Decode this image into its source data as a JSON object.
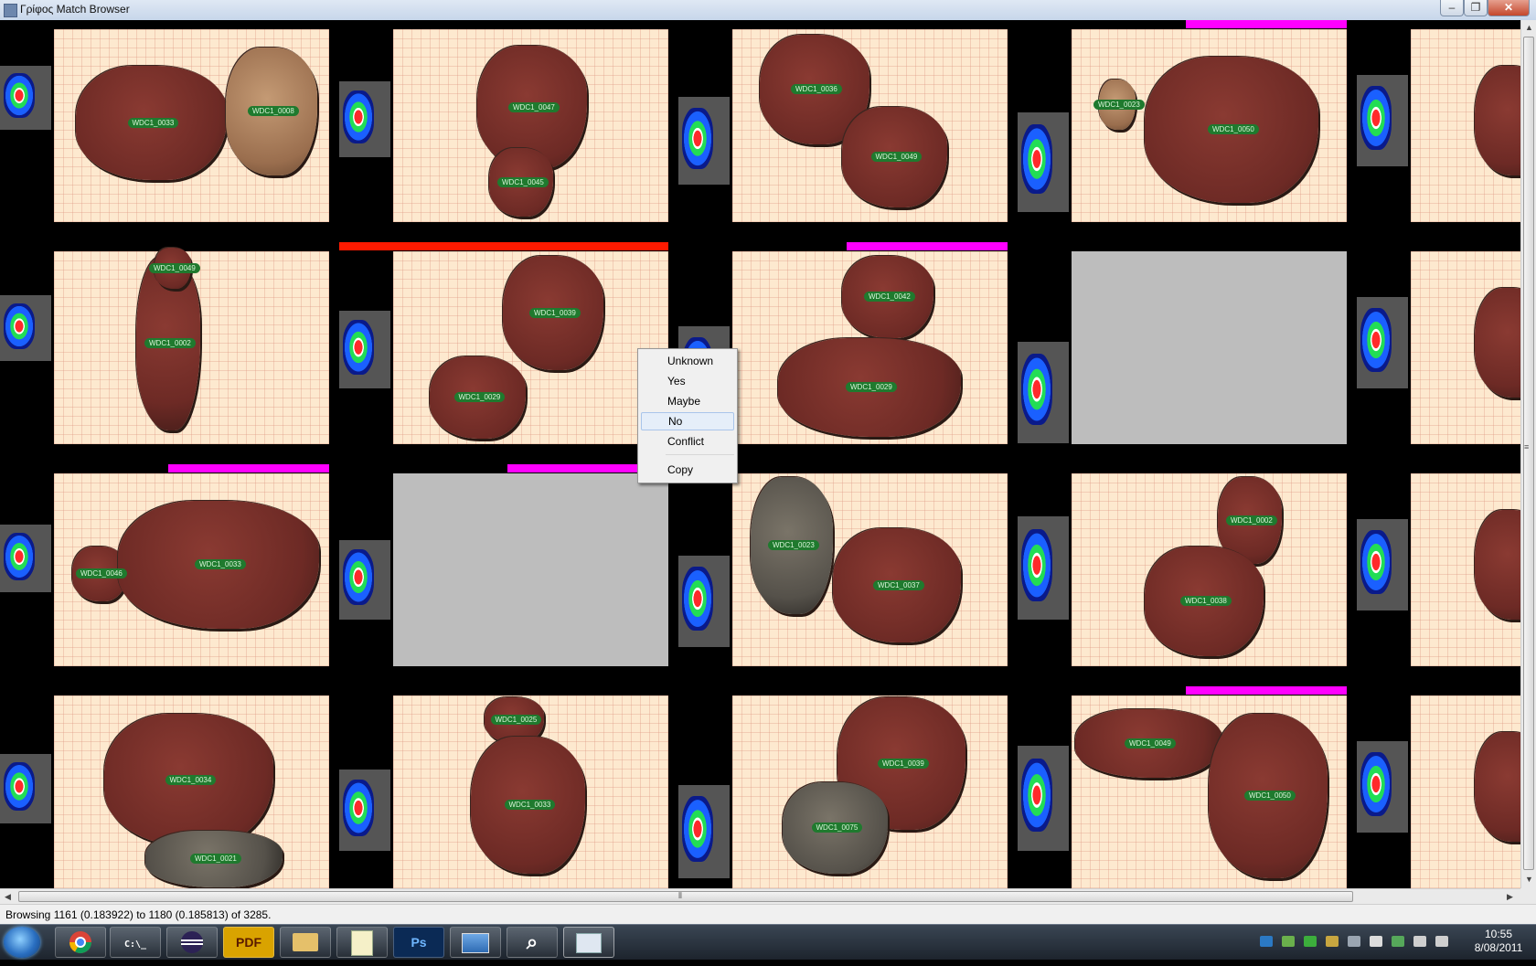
{
  "window": {
    "title": "Γρίφος Match Browser",
    "controls": {
      "minimize_icon": "minimize-icon",
      "maximize_icon": "maximize-icon",
      "close_icon": "close-icon"
    }
  },
  "tiles": [
    {
      "row": 0,
      "col": 0,
      "bar": null,
      "labels": [
        "WDC1_0033",
        "WDC1_0008"
      ]
    },
    {
      "row": 0,
      "col": 1,
      "bar": null,
      "labels": [
        "WDC1_0047",
        "WDC1_0045"
      ]
    },
    {
      "row": 0,
      "col": 2,
      "bar": null,
      "labels": [
        "WDC1_0036",
        "WDC1_0049"
      ]
    },
    {
      "row": 0,
      "col": 3,
      "bar": {
        "color": "#ff00ff",
        "span": "right"
      },
      "labels": [
        "WDC1_0023",
        "WDC1_0050"
      ]
    },
    {
      "row": 1,
      "col": 0,
      "bar": null,
      "labels": [
        "WDC1_0002",
        "WDC1_0049"
      ]
    },
    {
      "row": 1,
      "col": 1,
      "bar": {
        "color": "#ff1a00",
        "span": "full"
      },
      "labels": [
        "WDC1_0039",
        "WDC1_0029"
      ]
    },
    {
      "row": 1,
      "col": 2,
      "bar": {
        "color": "#ff00ff",
        "span": "right"
      },
      "labels": [
        "WDC1_0042",
        "WDC1_0029"
      ]
    },
    {
      "row": 1,
      "col": 3,
      "bar": null,
      "labels": []
    },
    {
      "row": 2,
      "col": 0,
      "bar": {
        "color": "#ff00ff",
        "span": "right"
      },
      "labels": [
        "WDC1_0046",
        "WDC1_0033"
      ]
    },
    {
      "row": 2,
      "col": 1,
      "bar": {
        "color": "#ff00ff",
        "span": "right"
      },
      "labels": []
    },
    {
      "row": 2,
      "col": 2,
      "bar": null,
      "labels": [
        "WDC1_0023",
        "WDC1_0037"
      ]
    },
    {
      "row": 2,
      "col": 3,
      "bar": null,
      "labels": [
        "WDC1_0002",
        "WDC1_0038"
      ]
    },
    {
      "row": 3,
      "col": 0,
      "bar": null,
      "labels": [
        "WDC1_0034",
        "WDC1_0021"
      ]
    },
    {
      "row": 3,
      "col": 1,
      "bar": null,
      "labels": [
        "WDC1_0025",
        "WDC1_0033"
      ]
    },
    {
      "row": 3,
      "col": 2,
      "bar": null,
      "labels": [
        "WDC1_0039",
        "WDC1_0075"
      ]
    },
    {
      "row": 3,
      "col": 3,
      "bar": {
        "color": "#ff00ff",
        "span": "right"
      },
      "labels": [
        "WDC1_0049",
        "WDC1_0050"
      ]
    }
  ],
  "context_menu": {
    "items": [
      "Unknown",
      "Yes",
      "Maybe",
      "No",
      "Conflict"
    ],
    "highlighted": "No",
    "copy": "Copy"
  },
  "status": {
    "text": "Browsing 1161 (0.183922) to 1180 (0.185813) of 3285."
  },
  "taskbar": {
    "apps": [
      "start-icon",
      "chrome-icon",
      "cmd-icon",
      "eclipse-icon",
      "pdf-icon",
      "folder-icon",
      "notepad-icon",
      "photoshop-icon",
      "photo-viewer-icon",
      "search-icon",
      "window-icon"
    ],
    "pdf_label": "PDF",
    "ps_label": "Ps",
    "clock": {
      "time": "10:55",
      "date": "8/08/2011"
    }
  }
}
